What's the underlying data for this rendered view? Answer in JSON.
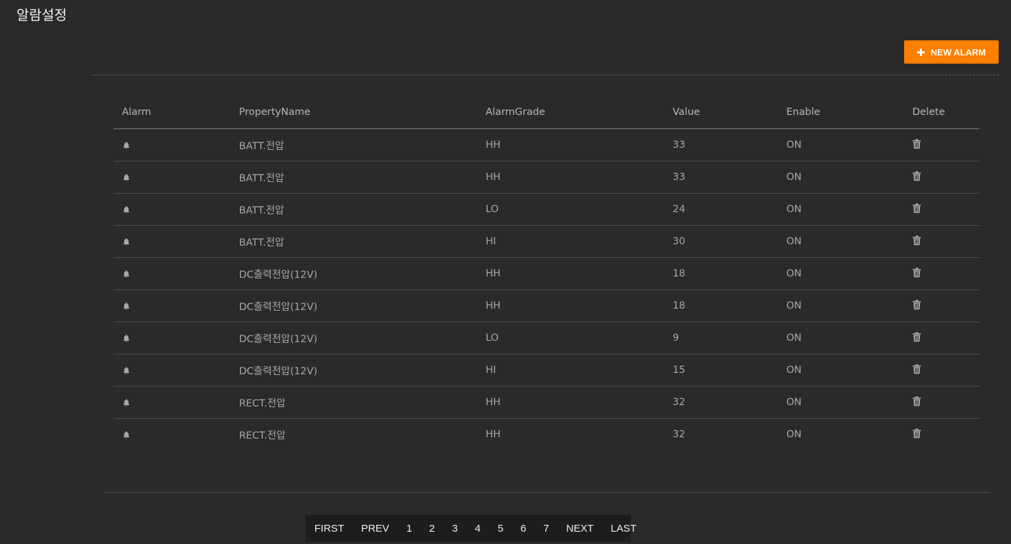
{
  "page": {
    "title": "알람설정"
  },
  "toolbar": {
    "new_alarm_label": "NEW ALARM",
    "accent_color": "#ff7f00"
  },
  "table": {
    "columns": {
      "alarm": "Alarm",
      "property_name": "PropertyName",
      "alarm_grade": "AlarmGrade",
      "value": "Value",
      "enable": "Enable",
      "delete": "Delete"
    },
    "rows": [
      {
        "property_name": "BATT.전압",
        "alarm_grade": "HH",
        "value": "33",
        "enable": "ON"
      },
      {
        "property_name": "BATT.전압",
        "alarm_grade": "HH",
        "value": "33",
        "enable": "ON"
      },
      {
        "property_name": "BATT.전압",
        "alarm_grade": "LO",
        "value": "24",
        "enable": "ON"
      },
      {
        "property_name": "BATT.전압",
        "alarm_grade": "HI",
        "value": "30",
        "enable": "ON"
      },
      {
        "property_name": "DC출력전압(12V)",
        "alarm_grade": "HH",
        "value": "18",
        "enable": "ON"
      },
      {
        "property_name": "DC출력전압(12V)",
        "alarm_grade": "HH",
        "value": "18",
        "enable": "ON"
      },
      {
        "property_name": "DC출력전압(12V)",
        "alarm_grade": "LO",
        "value": "9",
        "enable": "ON"
      },
      {
        "property_name": "DC출력전압(12V)",
        "alarm_grade": "HI",
        "value": "15",
        "enable": "ON"
      },
      {
        "property_name": "RECT.전압",
        "alarm_grade": "HH",
        "value": "32",
        "enable": "ON"
      },
      {
        "property_name": "RECT.전압",
        "alarm_grade": "HH",
        "value": "32",
        "enable": "ON"
      }
    ],
    "row_icon": "bell-icon",
    "delete_icon": "trash-icon"
  },
  "pagination": {
    "first": "FIRST",
    "prev": "PREV",
    "pages": [
      "1",
      "2",
      "3",
      "4",
      "5",
      "6",
      "7"
    ],
    "next": "NEXT",
    "last": "LAST"
  }
}
